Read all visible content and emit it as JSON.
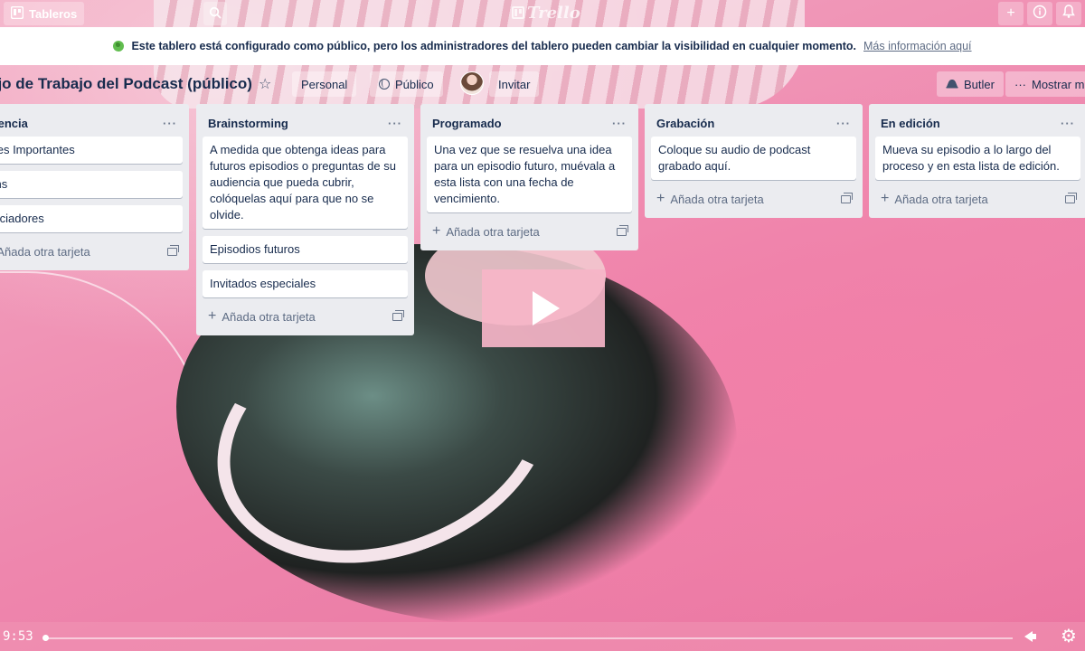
{
  "nav": {
    "boards_label": "Tableros",
    "logo_text": "Trello"
  },
  "banner": {
    "text": "Este tablero está configurado como público, pero los administradores del tablero pueden cambiar la visibilidad en cualquier momento.",
    "link": "Más información aquí"
  },
  "board": {
    "title": "ajo de Trabajo del Podcast (público)",
    "team_label": "Personal",
    "visibility_label": "Público",
    "invite_label": "Invitar",
    "butler_label": "Butler",
    "menu_label": "Mostrar me"
  },
  "lists": [
    {
      "title": "ferencia",
      "cards": [
        "aces Importantes",
        "t-Ins",
        "spiciadores"
      ],
      "add_label": "Añada otra tarjeta"
    },
    {
      "title": "Brainstorming",
      "cards": [
        "A medida que obtenga ideas para futuros episodios o preguntas de su audiencia que pueda cubrir, colóquelas aquí para que no se olvide.",
        "Episodios futuros",
        "Invitados especiales"
      ],
      "add_label": "Añada otra tarjeta"
    },
    {
      "title": "Programado",
      "cards": [
        "Una vez que se resuelva una idea para un episodio futuro, muévala a esta lista con una fecha de vencimiento."
      ],
      "add_label": "Añada otra tarjeta"
    },
    {
      "title": "Grabación",
      "cards": [
        "Coloque su audio de podcast grabado aquí."
      ],
      "add_label": "Añada otra tarjeta"
    },
    {
      "title": "En edición",
      "cards": [
        "Mueva su episodio a lo largo del proceso y en esta lista de edición."
      ],
      "add_label": "Añada otra tarjeta"
    }
  ],
  "video": {
    "time": "9:53",
    "progress_fraction": 0.002
  },
  "colors": {
    "list_bg": "#ebecf0",
    "text": "#172b4d",
    "banner_globe": "#61bd4f"
  }
}
